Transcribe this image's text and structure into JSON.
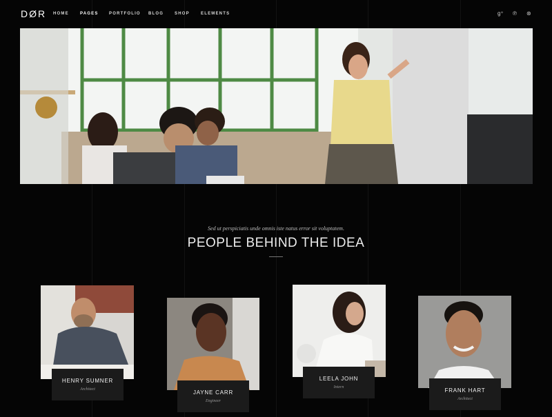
{
  "header": {
    "logo": "DØR",
    "nav": [
      "HOME",
      "PAGES",
      "PORTFOLIO",
      "BLOG",
      "SHOP",
      "ELEMENTS"
    ],
    "social_icons": [
      "google-plus-icon",
      "pinterest-icon",
      "dribbble-icon"
    ],
    "social_glyphs": [
      "g⁺",
      "℗",
      "⊛"
    ]
  },
  "intro": {
    "subtitle": "Sed ut perspiciatis unde omnis iste natus error sit voluptatem.",
    "title": "PEOPLE BEHIND THE IDEA"
  },
  "team": [
    {
      "name": "HENRY SUMNER",
      "role": "Architect"
    },
    {
      "name": "JAYNE CARR",
      "role": "Engineer"
    },
    {
      "name": "LEELA JOHN",
      "role": "Intern"
    },
    {
      "name": "FRANK HART",
      "role": "Architect"
    }
  ],
  "colors": {
    "background": "#050505",
    "label_bg": "#1b1b1b",
    "text": "#ececec"
  }
}
